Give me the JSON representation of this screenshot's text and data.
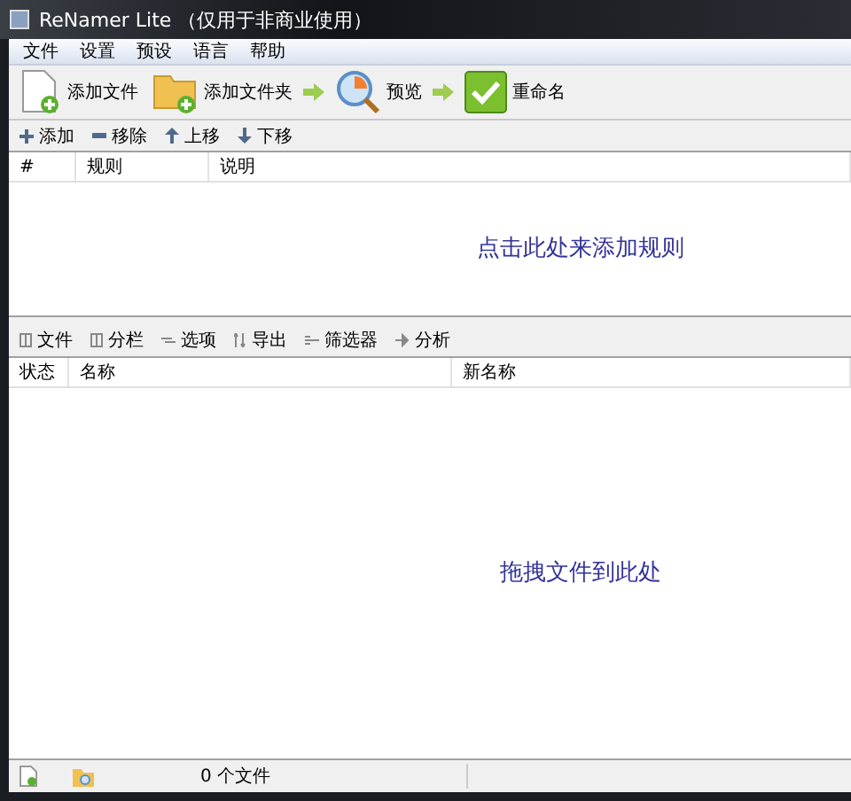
{
  "window": {
    "title": "ReNamer Lite （仅用于非商业使用）"
  },
  "menu": [
    "文件",
    "设置",
    "预设",
    "语言",
    "帮助"
  ],
  "toolbar": [
    {
      "kind": "add-file",
      "label": "添加文件"
    },
    {
      "kind": "add-folder",
      "label": "添加文件夹"
    },
    {
      "kind": "preview",
      "label": "预览"
    },
    {
      "kind": "rename",
      "label": "重命名"
    }
  ],
  "rules_toolbar": [
    {
      "kind": "plus",
      "label": "添加"
    },
    {
      "kind": "minus",
      "label": "移除"
    },
    {
      "kind": "up",
      "label": "上移"
    },
    {
      "kind": "down",
      "label": "下移"
    }
  ],
  "rules_table": {
    "columns": [
      "#",
      "规则",
      "说明"
    ],
    "hint": "点击此处来添加规则"
  },
  "files_toolbar": [
    {
      "kind": "files",
      "label": "文件"
    },
    {
      "kind": "columns",
      "label": "分栏"
    },
    {
      "kind": "options",
      "label": "选项"
    },
    {
      "kind": "export",
      "label": "导出"
    },
    {
      "kind": "filter",
      "label": "筛选器"
    },
    {
      "kind": "analyze",
      "label": "分析"
    }
  ],
  "files_table": {
    "columns": [
      "状态",
      "名称",
      "新名称"
    ],
    "hint": "拖拽文件到此处"
  },
  "status_bar": {
    "count": "0 个文件"
  }
}
